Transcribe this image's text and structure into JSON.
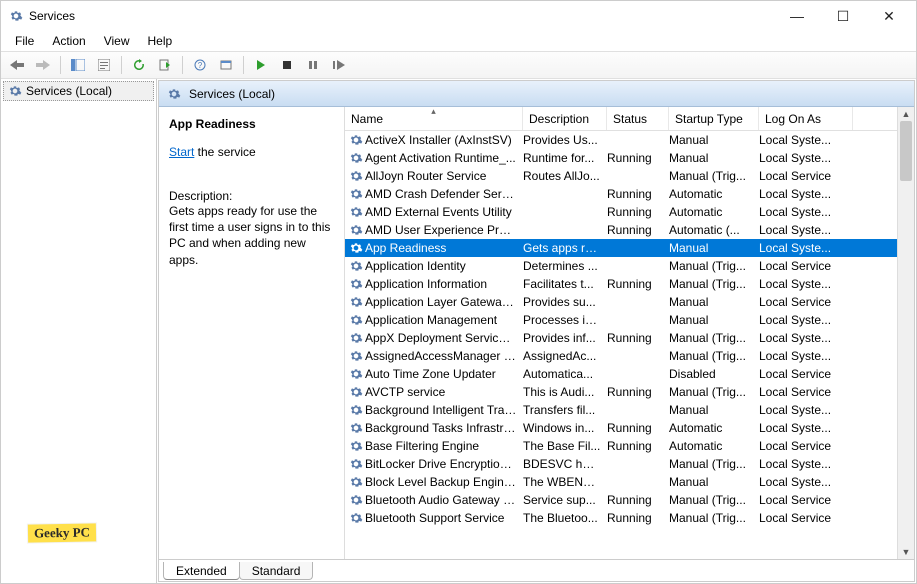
{
  "window": {
    "title": "Services"
  },
  "menu": {
    "file": "File",
    "action": "Action",
    "view": "View",
    "help": "Help"
  },
  "tree": {
    "root": "Services (Local)"
  },
  "pane": {
    "title": "Services (Local)"
  },
  "detail": {
    "service_name": "App Readiness",
    "start_link": "Start",
    "start_suffix": " the service",
    "desc_label": "Description:",
    "desc_text": "Gets apps ready for use the first time a user signs in to this PC and when adding new apps."
  },
  "columns": {
    "name": "Name",
    "description": "Description",
    "status": "Status",
    "startup": "Startup Type",
    "logon": "Log On As"
  },
  "rows": [
    {
      "name": "ActiveX Installer (AxInstSV)",
      "desc": "Provides Us...",
      "status": "",
      "startup": "Manual",
      "logon": "Local Syste..."
    },
    {
      "name": "Agent Activation Runtime_...",
      "desc": "Runtime for...",
      "status": "Running",
      "startup": "Manual",
      "logon": "Local Syste..."
    },
    {
      "name": "AllJoyn Router Service",
      "desc": "Routes AllJo...",
      "status": "",
      "startup": "Manual (Trig...",
      "logon": "Local Service"
    },
    {
      "name": "AMD Crash Defender Service",
      "desc": "",
      "status": "Running",
      "startup": "Automatic",
      "logon": "Local Syste..."
    },
    {
      "name": "AMD External Events Utility",
      "desc": "",
      "status": "Running",
      "startup": "Automatic",
      "logon": "Local Syste..."
    },
    {
      "name": "AMD User Experience Progr...",
      "desc": "",
      "status": "Running",
      "startup": "Automatic (...",
      "logon": "Local Syste..."
    },
    {
      "name": "App Readiness",
      "desc": "Gets apps re...",
      "status": "",
      "startup": "Manual",
      "logon": "Local Syste...",
      "selected": true
    },
    {
      "name": "Application Identity",
      "desc": "Determines ...",
      "status": "",
      "startup": "Manual (Trig...",
      "logon": "Local Service"
    },
    {
      "name": "Application Information",
      "desc": "Facilitates t...",
      "status": "Running",
      "startup": "Manual (Trig...",
      "logon": "Local Syste..."
    },
    {
      "name": "Application Layer Gateway ...",
      "desc": "Provides su...",
      "status": "",
      "startup": "Manual",
      "logon": "Local Service"
    },
    {
      "name": "Application Management",
      "desc": "Processes in...",
      "status": "",
      "startup": "Manual",
      "logon": "Local Syste..."
    },
    {
      "name": "AppX Deployment Service (...",
      "desc": "Provides inf...",
      "status": "Running",
      "startup": "Manual (Trig...",
      "logon": "Local Syste..."
    },
    {
      "name": "AssignedAccessManager Se...",
      "desc": "AssignedAc...",
      "status": "",
      "startup": "Manual (Trig...",
      "logon": "Local Syste..."
    },
    {
      "name": "Auto Time Zone Updater",
      "desc": "Automatica...",
      "status": "",
      "startup": "Disabled",
      "logon": "Local Service"
    },
    {
      "name": "AVCTP service",
      "desc": "This is Audi...",
      "status": "Running",
      "startup": "Manual (Trig...",
      "logon": "Local Service"
    },
    {
      "name": "Background Intelligent Tran...",
      "desc": "Transfers fil...",
      "status": "",
      "startup": "Manual",
      "logon": "Local Syste..."
    },
    {
      "name": "Background Tasks Infrastruc...",
      "desc": "Windows in...",
      "status": "Running",
      "startup": "Automatic",
      "logon": "Local Syste..."
    },
    {
      "name": "Base Filtering Engine",
      "desc": "The Base Fil...",
      "status": "Running",
      "startup": "Automatic",
      "logon": "Local Service"
    },
    {
      "name": "BitLocker Drive Encryption ...",
      "desc": "BDESVC hos...",
      "status": "",
      "startup": "Manual (Trig...",
      "logon": "Local Syste..."
    },
    {
      "name": "Block Level Backup Engine ...",
      "desc": "The WBENG...",
      "status": "",
      "startup": "Manual",
      "logon": "Local Syste..."
    },
    {
      "name": "Bluetooth Audio Gateway S...",
      "desc": "Service sup...",
      "status": "Running",
      "startup": "Manual (Trig...",
      "logon": "Local Service"
    },
    {
      "name": "Bluetooth Support Service",
      "desc": "The Bluetoo...",
      "status": "Running",
      "startup": "Manual (Trig...",
      "logon": "Local Service"
    }
  ],
  "tabs": {
    "extended": "Extended",
    "standard": "Standard"
  },
  "watermark": "Geeky PC"
}
